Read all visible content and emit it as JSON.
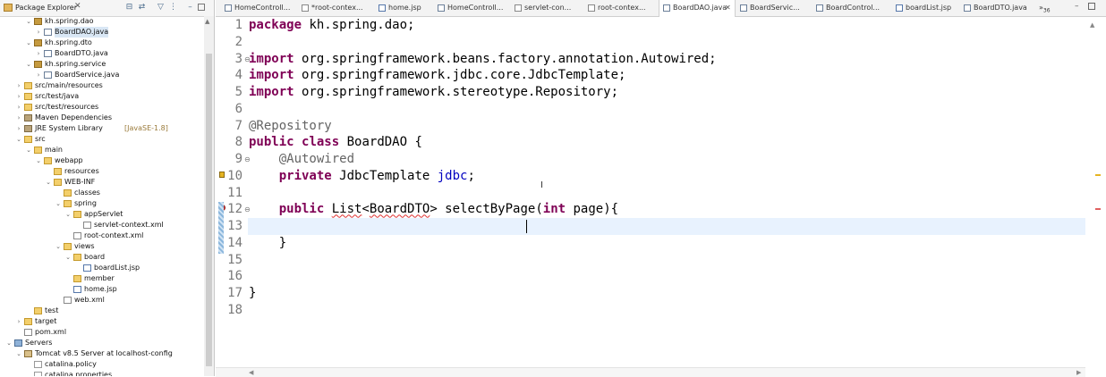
{
  "explorer": {
    "title": "Package Explorer",
    "close_glyph": "✕",
    "tree": [
      {
        "label": "kh.spring.dao",
        "icon": "package-icon",
        "depth": 2,
        "twisty": "open"
      },
      {
        "label": "BoardDAO.java",
        "icon": "java-file-icon",
        "depth": 3,
        "twisty": "closed",
        "selected": true
      },
      {
        "label": "kh.spring.dto",
        "icon": "package-icon",
        "depth": 2,
        "twisty": "open"
      },
      {
        "label": "BoardDTO.java",
        "icon": "java-file-icon",
        "depth": 3,
        "twisty": "closed"
      },
      {
        "label": "kh.spring.service",
        "icon": "package-icon",
        "depth": 2,
        "twisty": "open"
      },
      {
        "label": "BoardService.java",
        "icon": "java-file-icon",
        "depth": 3,
        "twisty": "closed"
      },
      {
        "label": "src/main/resources",
        "icon": "source-folder-icon",
        "depth": 1,
        "twisty": "closed"
      },
      {
        "label": "src/test/java",
        "icon": "source-folder-icon",
        "depth": 1,
        "twisty": "closed"
      },
      {
        "label": "src/test/resources",
        "icon": "source-folder-icon",
        "depth": 1,
        "twisty": "closed"
      },
      {
        "label": "Maven Dependencies",
        "icon": "library-icon",
        "depth": 1,
        "twisty": "closed"
      },
      {
        "label": "JRE System Library",
        "decoration": "[JavaSE-1.8]",
        "icon": "library-icon",
        "depth": 1,
        "twisty": "closed"
      },
      {
        "label": "src",
        "icon": "folder-icon",
        "depth": 1,
        "twisty": "open"
      },
      {
        "label": "main",
        "icon": "folder-icon",
        "depth": 2,
        "twisty": "open"
      },
      {
        "label": "webapp",
        "icon": "folder-icon",
        "depth": 3,
        "twisty": "open"
      },
      {
        "label": "resources",
        "icon": "folder-icon",
        "depth": 4,
        "twisty": "none"
      },
      {
        "label": "WEB-INF",
        "icon": "folder-icon",
        "depth": 4,
        "twisty": "open"
      },
      {
        "label": "classes",
        "icon": "folder-icon",
        "depth": 5,
        "twisty": "none"
      },
      {
        "label": "spring",
        "icon": "folder-icon",
        "depth": 5,
        "twisty": "open"
      },
      {
        "label": "appServlet",
        "icon": "folder-icon",
        "depth": 6,
        "twisty": "open"
      },
      {
        "label": "servlet-context.xml",
        "icon": "xml-file-icon",
        "depth": 7,
        "twisty": "none"
      },
      {
        "label": "root-context.xml",
        "icon": "xml-file-icon",
        "depth": 6,
        "twisty": "none"
      },
      {
        "label": "views",
        "icon": "folder-icon",
        "depth": 5,
        "twisty": "open"
      },
      {
        "label": "board",
        "icon": "folder-icon",
        "depth": 6,
        "twisty": "open"
      },
      {
        "label": "boardList.jsp",
        "icon": "jsp-file-icon",
        "depth": 7,
        "twisty": "none"
      },
      {
        "label": "member",
        "icon": "folder-icon",
        "depth": 6,
        "twisty": "none"
      },
      {
        "label": "home.jsp",
        "icon": "jsp-file-icon",
        "depth": 6,
        "twisty": "none"
      },
      {
        "label": "web.xml",
        "icon": "xml-file-icon",
        "depth": 5,
        "twisty": "none"
      },
      {
        "label": "test",
        "icon": "folder-icon",
        "depth": 2,
        "twisty": "none"
      },
      {
        "label": "target",
        "icon": "folder-icon",
        "depth": 1,
        "twisty": "closed"
      },
      {
        "label": "pom.xml",
        "icon": "xml-file-icon",
        "depth": 1,
        "twisty": "none"
      },
      {
        "label": "Servers",
        "icon": "server-icon",
        "depth": 0,
        "twisty": "open"
      },
      {
        "label": "Tomcat v8.5 Server at localhost-config",
        "icon": "tomcat-icon",
        "depth": 1,
        "twisty": "open"
      },
      {
        "label": "catalina.policy",
        "icon": "file-icon",
        "depth": 2,
        "twisty": "none"
      },
      {
        "label": "catalina.properties",
        "icon": "file-icon",
        "depth": 2,
        "twisty": "none"
      }
    ]
  },
  "editor": {
    "tabs": [
      {
        "label": "HomeControll...",
        "icon": "java-file-icon"
      },
      {
        "label": "*root-contex...",
        "icon": "xml-file-icon"
      },
      {
        "label": "home.jsp",
        "icon": "jsp-file-icon"
      },
      {
        "label": "HomeControll...",
        "icon": "java-file-icon"
      },
      {
        "label": "servlet-con...",
        "icon": "xml-file-icon"
      },
      {
        "label": "root-contex...",
        "icon": "xml-file-icon"
      },
      {
        "label": "BoardDAO.java",
        "icon": "java-file-icon",
        "active": true
      },
      {
        "label": "BoardServic...",
        "icon": "java-file-icon"
      },
      {
        "label": "BoardControl...",
        "icon": "java-file-icon"
      },
      {
        "label": "boardList.jsp",
        "icon": "jsp-file-icon"
      },
      {
        "label": "BoardDTO.java",
        "icon": "java-file-icon"
      }
    ],
    "tab_close_glyph": "✕",
    "overflow_label": "»",
    "overflow_count": "36",
    "line_numbers": [
      "1",
      "2",
      "3",
      "4",
      "5",
      "6",
      "7",
      "8",
      "9",
      "10",
      "11",
      "12",
      "13",
      "14",
      "15",
      "16",
      "17",
      "18"
    ],
    "code_lines": [
      [
        {
          "t": "package",
          "c": "kw"
        },
        {
          "t": " kh.spring.dao;"
        }
      ],
      [],
      [
        {
          "t": "import",
          "c": "kw"
        },
        {
          "t": " org.springframework.beans.factory.annotation.Autowired;"
        }
      ],
      [
        {
          "t": "import",
          "c": "kw"
        },
        {
          "t": " org.springframework.jdbc.core.JdbcTemplate;"
        }
      ],
      [
        {
          "t": "import",
          "c": "kw"
        },
        {
          "t": " org.springframework.stereotype.Repository;"
        }
      ],
      [],
      [
        {
          "t": "@Repository",
          "c": "ann"
        }
      ],
      [
        {
          "t": "public",
          "c": "kw"
        },
        {
          "t": " "
        },
        {
          "t": "class",
          "c": "kw"
        },
        {
          "t": " BoardDAO {"
        }
      ],
      [
        {
          "t": "    "
        },
        {
          "t": "@Autowired",
          "c": "ann"
        }
      ],
      [
        {
          "t": "    "
        },
        {
          "t": "private",
          "c": "kw"
        },
        {
          "t": " JdbcTemplate "
        },
        {
          "t": "jdbc",
          "c": "fld"
        },
        {
          "t": ";"
        }
      ],
      [],
      [
        {
          "t": "    "
        },
        {
          "t": "public",
          "c": "kw"
        },
        {
          "t": " "
        },
        {
          "t": "List",
          "c": "err"
        },
        {
          "t": "<"
        },
        {
          "t": "BoardDTO",
          "c": "err"
        },
        {
          "t": "> selectByPage("
        },
        {
          "t": "int",
          "c": "kw"
        },
        {
          "t": " page){"
        }
      ],
      [
        {
          "t": "        "
        }
      ],
      [
        {
          "t": "    }"
        }
      ],
      [],
      [],
      [
        {
          "t": "}"
        }
      ],
      []
    ]
  }
}
